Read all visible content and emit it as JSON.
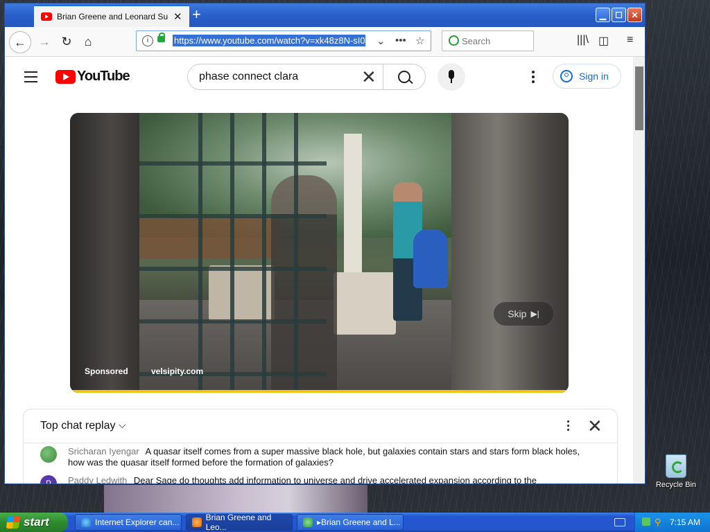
{
  "browser": {
    "tab_title": "Brian Greene and Leonard Susskind",
    "tab_close": "✕",
    "new_tab": "+",
    "window_buttons": {
      "minimize": "▁",
      "maximize": "☐",
      "close": "✕"
    },
    "url": "https://www.youtube.com/watch?v=xk48z8N-sI0",
    "search_placeholder": "Search"
  },
  "youtube": {
    "logo_text": "YouTube",
    "search_query": "phase connect clara",
    "sign_in": "Sign in"
  },
  "video": {
    "sponsored_label": "Sponsored",
    "ad_url": "velsipity.com",
    "skip_label": "Skip",
    "skip_icon": "▶|",
    "progress": 1.0,
    "progress_color": "#f2c511"
  },
  "chat": {
    "title": "Top chat replay",
    "chevron": "⌵",
    "close": "✕",
    "messages": [
      {
        "author": "Sricharan Iyengar",
        "avatar_initial": "",
        "text": "A quasar itself comes from a super massive black hole, but galaxies contain stars and stars form black holes, how was the quasar itself formed before the formation of galaxies?"
      },
      {
        "author": "Paddy Ledwith",
        "avatar_initial": "P",
        "text": "Dear Sage do thoughts add information to universe and drive accelerated expansion according to the holographic principle"
      }
    ]
  },
  "desktop": {
    "recycle_bin_label": "Recycle Bin"
  },
  "taskbar": {
    "start_label": "start",
    "tasks": [
      {
        "label": "Internet Explorer can..."
      },
      {
        "label": "Brian Greene and Leo..."
      },
      {
        "label": "▸Brian Greene and L..."
      }
    ],
    "clock": "7:15 AM"
  },
  "colors": {
    "youtube_red": "#ff0000",
    "link_blue": "#1769d6",
    "taskbar_blue": "#2456d0",
    "start_green": "#2e8b2e"
  }
}
